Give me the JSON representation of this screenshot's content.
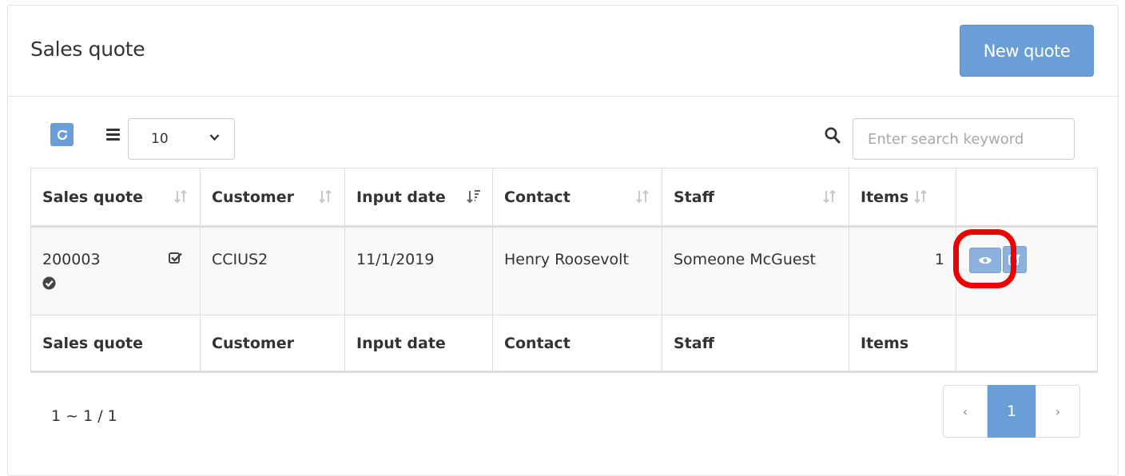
{
  "header": {
    "title": "Sales quote",
    "new_button_label": "New quote"
  },
  "toolbar": {
    "refresh_icon": "refresh-icon",
    "page_size_icon": "list-icon",
    "page_size_value": "10",
    "search_placeholder": "Enter search keyword",
    "search_value": ""
  },
  "table": {
    "columns": [
      "Sales quote",
      "Customer",
      "Input date",
      "Contact",
      "Staff",
      "Items",
      ""
    ],
    "sorted_column": "Input date",
    "rows": [
      {
        "sales_quote": "200003",
        "customer": "CCIUS2",
        "input_date": "11/1/2019",
        "contact": "Henry Roosevolt",
        "staff": "Someone McGuest",
        "items": "1"
      }
    ],
    "footer": [
      "Sales quote",
      "Customer",
      "Input date",
      "Contact",
      "Staff",
      "Items",
      ""
    ]
  },
  "pagination": {
    "summary": "1 ~ 1 / 1",
    "prev": "‹",
    "current": "1",
    "next": "›"
  },
  "colors": {
    "primary": "#6a9ed6",
    "highlight": "#ee0000"
  }
}
